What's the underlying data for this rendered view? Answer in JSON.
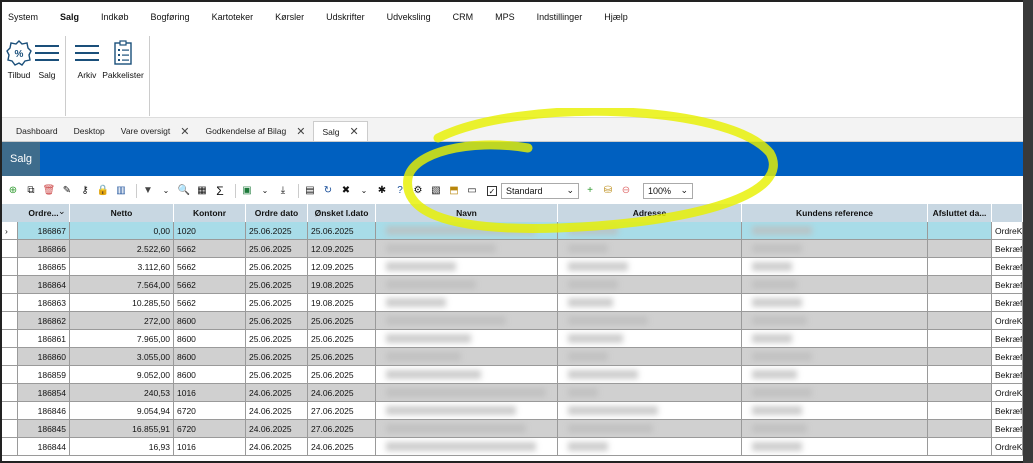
{
  "menu": [
    "System",
    "Salg",
    "Indkøb",
    "Bogføring",
    "Kartoteker",
    "Kørsler",
    "Udskrifter",
    "Udveksling",
    "CRM",
    "MPS",
    "Indstillinger",
    "Hjælp"
  ],
  "ribbon": {
    "group1": [
      {
        "label": "Tilbud",
        "icon": "percent-gear-icon"
      },
      {
        "label": "Salg",
        "icon": "lines-icon"
      }
    ],
    "group2": [
      {
        "label": "Arkiv",
        "icon": "lines-icon"
      },
      {
        "label": "Pakkelister",
        "icon": "clipboard-list-icon"
      }
    ]
  },
  "tabs": [
    {
      "label": "Dashboard",
      "closable": false
    },
    {
      "label": "Desktop",
      "closable": false
    },
    {
      "label": "Vare oversigt",
      "closable": true
    },
    {
      "label": "Godkendelse af Bilag",
      "closable": true
    },
    {
      "label": "Salg",
      "closable": true,
      "active": true
    }
  ],
  "title": "Salg",
  "toolbar": {
    "view_select": "Standard",
    "zoom": "100%",
    "checkbox_checked": true
  },
  "columns": [
    "Ordre...",
    "Netto",
    "Kontonr",
    "Ordre dato",
    "Ønsket l.dato",
    "Navn",
    "Adresse",
    "Kundens reference",
    "Afsluttet da...",
    ""
  ],
  "rows": [
    {
      "ordre": "186867",
      "netto": "0,00",
      "konto": "1020",
      "dato": "25.06.2025",
      "ldato": "25.06.2025",
      "status": "OrdreKl"
    },
    {
      "ordre": "186866",
      "netto": "2.522,60",
      "konto": "5662",
      "dato": "25.06.2025",
      "ldato": "12.09.2025",
      "status": "Bekræft"
    },
    {
      "ordre": "186865",
      "netto": "3.112,60",
      "konto": "5662",
      "dato": "25.06.2025",
      "ldato": "12.09.2025",
      "status": "Bekræft"
    },
    {
      "ordre": "186864",
      "netto": "7.564,00",
      "konto": "5662",
      "dato": "25.06.2025",
      "ldato": "19.08.2025",
      "status": "Bekræft"
    },
    {
      "ordre": "186863",
      "netto": "10.285,50",
      "konto": "5662",
      "dato": "25.06.2025",
      "ldato": "19.08.2025",
      "status": "Bekræft"
    },
    {
      "ordre": "186862",
      "netto": "272,00",
      "konto": "8600",
      "dato": "25.06.2025",
      "ldato": "25.06.2025",
      "status": "OrdreKl"
    },
    {
      "ordre": "186861",
      "netto": "7.965,00",
      "konto": "8600",
      "dato": "25.06.2025",
      "ldato": "25.06.2025",
      "status": "Bekræft"
    },
    {
      "ordre": "186860",
      "netto": "3.055,00",
      "konto": "8600",
      "dato": "25.06.2025",
      "ldato": "25.06.2025",
      "status": "Bekræft"
    },
    {
      "ordre": "186859",
      "netto": "9.052,00",
      "konto": "8600",
      "dato": "25.06.2025",
      "ldato": "25.06.2025",
      "status": "Bekræft"
    },
    {
      "ordre": "186854",
      "netto": "240,53",
      "konto": "1016",
      "dato": "24.06.2025",
      "ldato": "24.06.2025",
      "status": "OrdreKl"
    },
    {
      "ordre": "186846",
      "netto": "9.054,94",
      "konto": "6720",
      "dato": "24.06.2025",
      "ldato": "27.06.2025",
      "status": "Bekræft"
    },
    {
      "ordre": "186845",
      "netto": "16.855,91",
      "konto": "6720",
      "dato": "24.06.2025",
      "ldato": "27.06.2025",
      "status": "Bekræft"
    },
    {
      "ordre": "186844",
      "netto": "16,93",
      "konto": "1016",
      "dato": "24.06.2025",
      "ldato": "24.06.2025",
      "status": "OrdreKl"
    }
  ],
  "colors": {
    "title_bar": "#0060c0",
    "selected_row": "#a8dce8",
    "alt_row": "#d0d0d0",
    "highlight": "#e8f000"
  }
}
